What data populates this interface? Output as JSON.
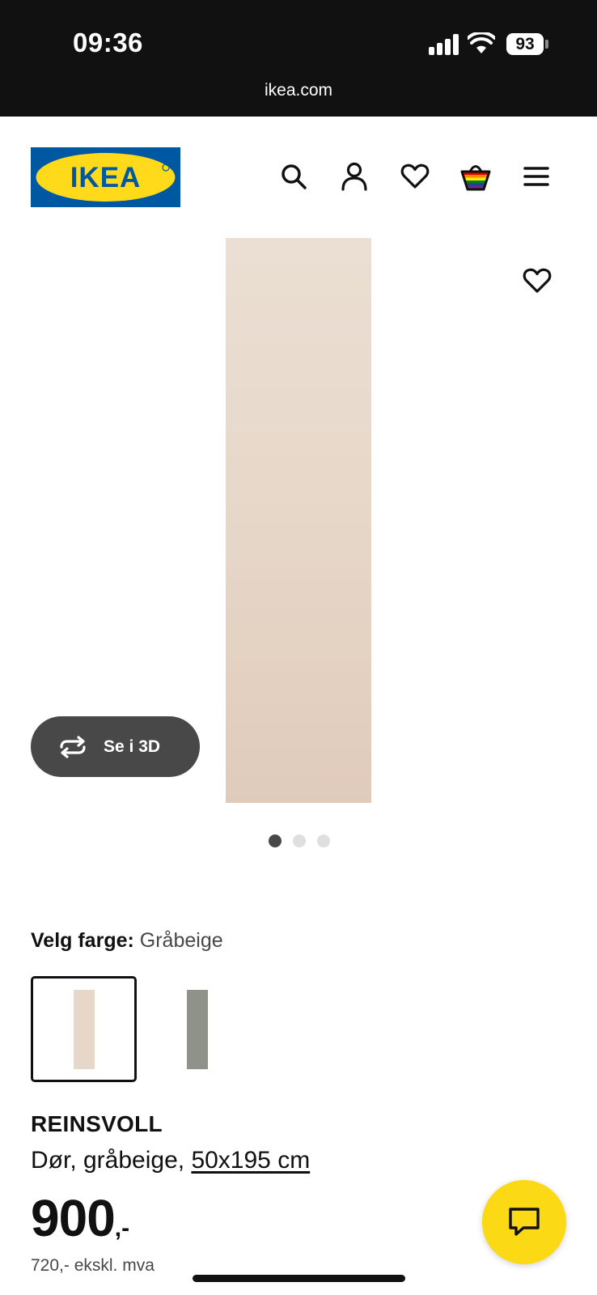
{
  "status_bar": {
    "time": "09:36",
    "battery": "93",
    "url": "ikea.com"
  },
  "header": {
    "logo_text": "IKEA",
    "icons": [
      "search-icon",
      "account-icon",
      "heart-icon",
      "basket-icon",
      "menu-icon"
    ]
  },
  "gallery": {
    "view_3d_label": "Se i 3D",
    "image_count": 3,
    "active_index": 0
  },
  "color": {
    "label": "Velg farge:",
    "selected": "Gråbeige",
    "options": [
      {
        "name": "Gråbeige",
        "hex": "#e6d7c9",
        "selected": true
      },
      {
        "name": "Grønn",
        "hex": "#8e9288",
        "selected": false
      }
    ]
  },
  "product": {
    "name": "REINSVOLL",
    "description": "Dør, gråbeige,",
    "size": "50x195 cm",
    "price": "900",
    "price_suffix": ",-",
    "price_ex_vat": "720,- ekskl. mva"
  },
  "colors": {
    "ikea_blue": "#0058a3",
    "ikea_yellow": "#ffda1a",
    "dark_button": "#484848",
    "chat_yellow": "#fbd914"
  }
}
